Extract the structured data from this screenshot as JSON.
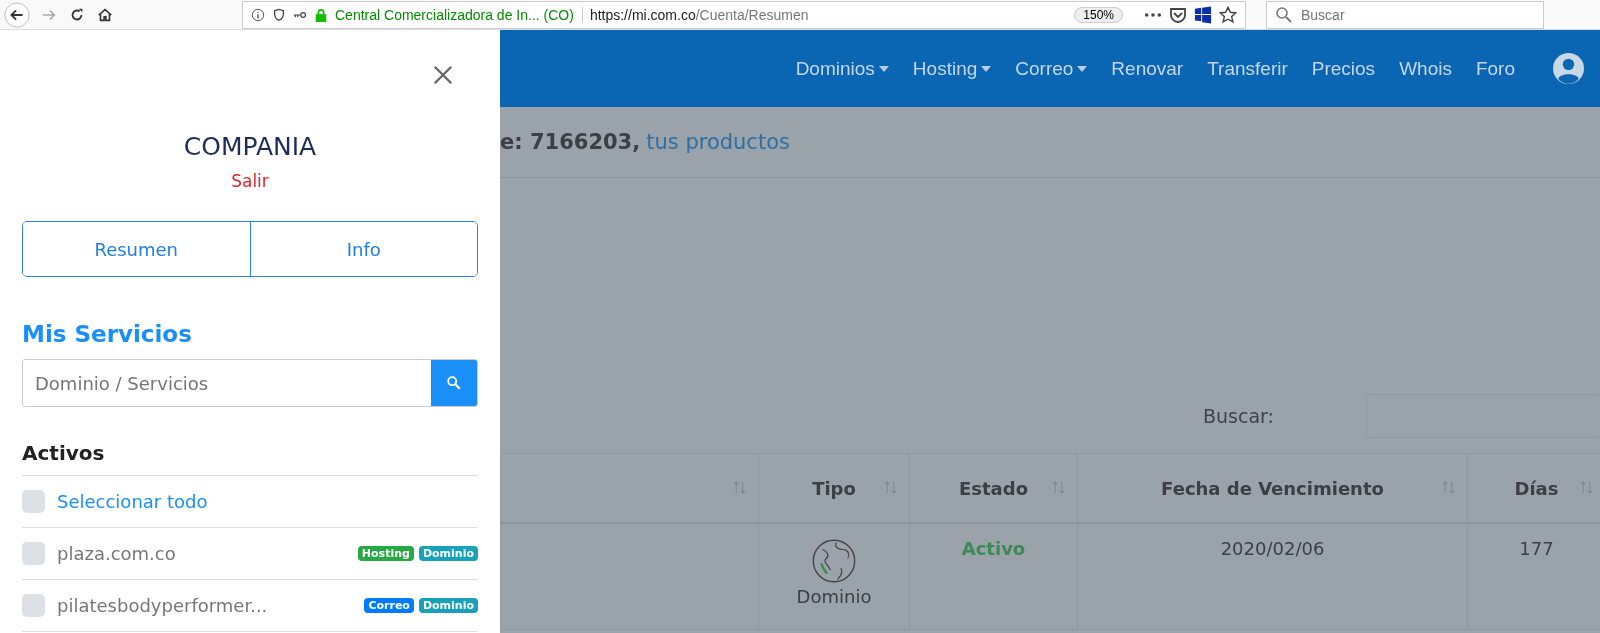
{
  "browser": {
    "site_name": "Central Comercializadora de In... (CO)",
    "url_host": "https://mi.com.co",
    "url_path": "/Cuenta/Resumen",
    "zoom": "150%",
    "search_placeholder": "Buscar"
  },
  "navbar": {
    "items": [
      {
        "label": "Dominios",
        "dropdown": true
      },
      {
        "label": "Hosting",
        "dropdown": true
      },
      {
        "label": "Correo",
        "dropdown": true
      },
      {
        "label": "Renovar",
        "dropdown": false
      },
      {
        "label": "Transferir",
        "dropdown": false
      },
      {
        "label": "Precios",
        "dropdown": false
      },
      {
        "label": "Whois",
        "dropdown": false
      },
      {
        "label": "Foro",
        "dropdown": false
      }
    ]
  },
  "sidebar": {
    "company": "COMPANIA",
    "logout": "Salir",
    "tabs": [
      {
        "label": "Resumen"
      },
      {
        "label": "Info"
      }
    ],
    "section_title": "Mis Servicios",
    "search_placeholder": "Dominio / Servicios",
    "group_title": "Activos",
    "select_all": {
      "label": "Seleccionar todo",
      "checked": false
    },
    "services": [
      {
        "name": "plaza.com.co",
        "checked": false,
        "tags": [
          {
            "label": "Hosting",
            "color": "#28a745"
          },
          {
            "label": "Dominio",
            "color": "#17a2b8"
          }
        ]
      },
      {
        "name": "pilatesbodyperformer...",
        "checked": false,
        "tags": [
          {
            "label": "Correo",
            "color": "#007bff"
          },
          {
            "label": "Dominio",
            "color": "#17a2b8"
          }
        ]
      }
    ]
  },
  "main": {
    "header_text": "**e: 7166203**,",
    "header_link": "tus productos",
    "search_label": "Buscar:",
    "table": {
      "columns": [
        "",
        "Tipo",
        "Estado",
        "Fecha de Vencimiento",
        "Días"
      ],
      "rows": [
        {
          "type": "Dominio",
          "status": "Activo",
          "expiry": "2020/02/06",
          "days": "177"
        }
      ]
    }
  }
}
